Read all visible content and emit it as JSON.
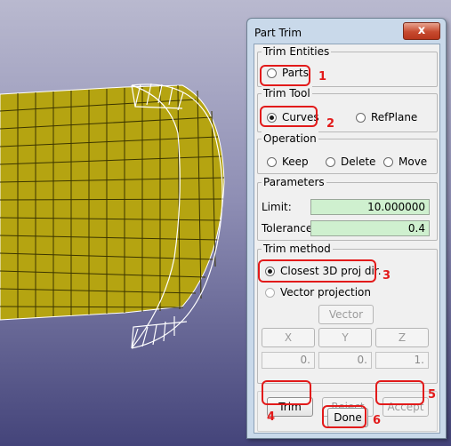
{
  "dialog": {
    "title": "Part Trim",
    "close_glyph": "x",
    "trim_entities": {
      "legend": "Trim Entities",
      "parts_label": "Parts",
      "parts_selected": false,
      "marker": "1"
    },
    "trim_tool": {
      "legend": "Trim Tool",
      "curves_label": "Curves",
      "curves_selected": true,
      "refplane_label": "RefPlane",
      "refplane_selected": false,
      "marker": "2"
    },
    "operation": {
      "legend": "Operation",
      "keep_label": "Keep",
      "delete_label": "Delete",
      "move_label": "Move"
    },
    "parameters": {
      "legend": "Parameters",
      "limit_label": "Limit:",
      "limit_value": "10.000000",
      "tolerance_label": "Tolerance:",
      "tolerance_value": "0.4"
    },
    "trim_method": {
      "legend": "Trim method",
      "closest_label": "Closest 3D proj dir.",
      "closest_selected": true,
      "vector_label": "Vector projection",
      "vector_selected": false,
      "vector_button": "Vector",
      "x_button": "X",
      "y_button": "Y",
      "z_button": "Z",
      "x_value": "0.",
      "y_value": "0.",
      "z_value": "1.",
      "marker": "3"
    },
    "buttons": {
      "trim": "Trim",
      "reject": "Reject",
      "accept": "Accept",
      "done": "Done",
      "trim_marker": "4",
      "accept_marker": "5",
      "done_marker": "6"
    }
  },
  "colors": {
    "surface_fill": "#b5a411",
    "mesh_line": "#3a3400",
    "annotation": "#e21a1a",
    "field_bg": "#cff0cf"
  }
}
